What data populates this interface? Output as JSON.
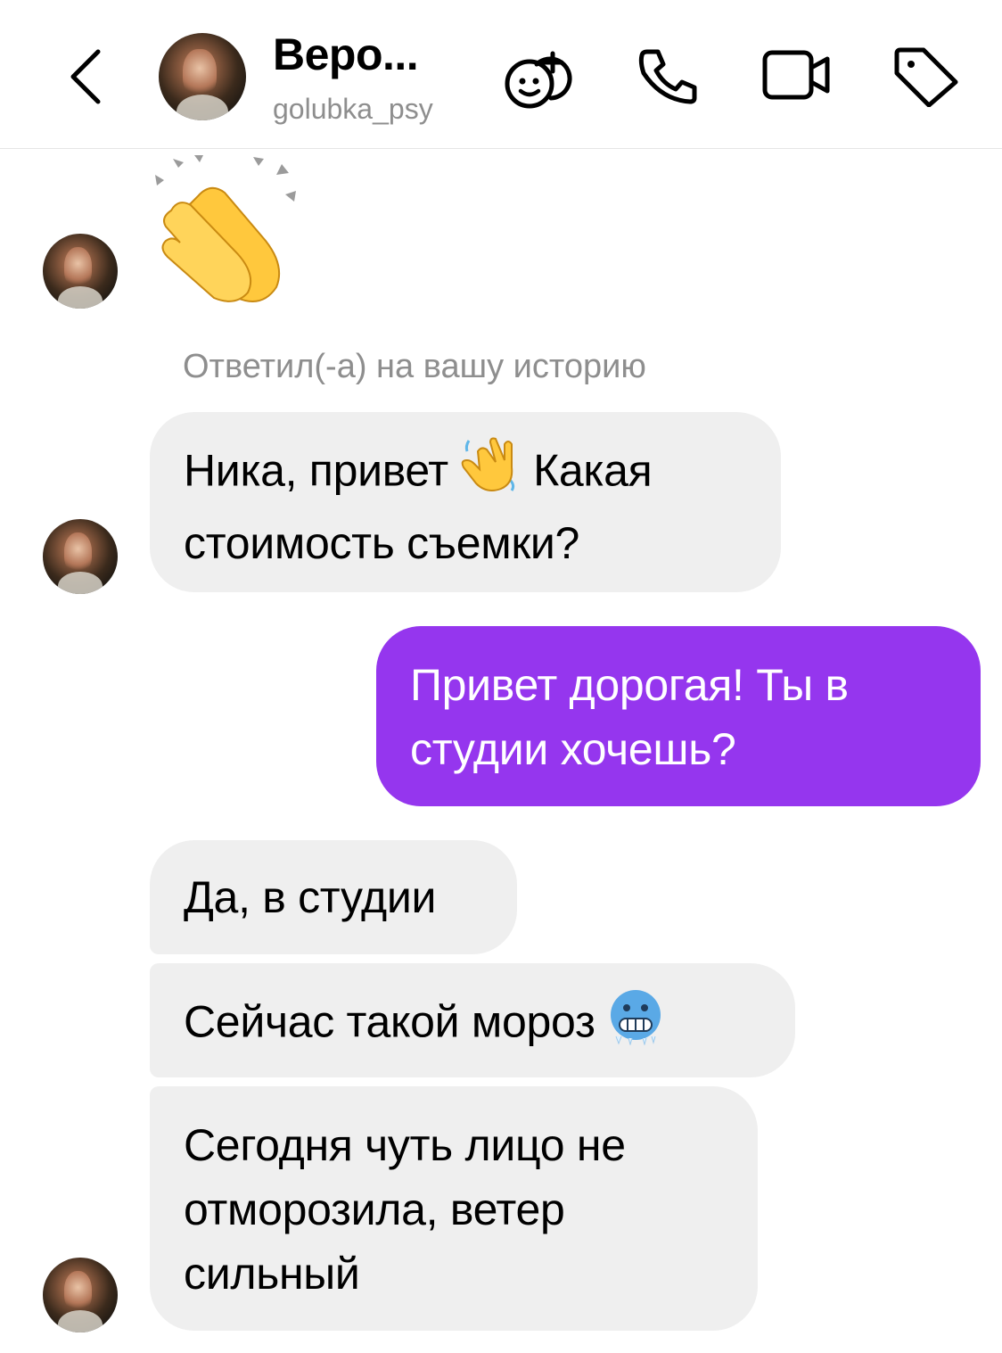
{
  "header": {
    "contact_name": "Веро...",
    "contact_handle": "golubka_psy",
    "icons": [
      "back-chevron-icon",
      "games-icon",
      "phone-icon",
      "video-camera-icon",
      "tag-icon"
    ]
  },
  "thread": {
    "story_reply_note": "Ответил(-а) на вашу историю",
    "messages": [
      {
        "from": "contact",
        "emoji": "clapping-hands"
      },
      {
        "from": "contact",
        "line1": "Ника, привет",
        "line1b": "Какая",
        "line2": "стоимость съемки?",
        "emoji": "waving-hand"
      },
      {
        "from": "me",
        "line1": "Привет дорогая! Ты в",
        "line2": "студии хочешь?"
      },
      {
        "from": "contact",
        "line1": "Да, в студии"
      },
      {
        "from": "contact",
        "line1": "Сейчас такой мороз",
        "emoji": "cold-face"
      },
      {
        "from": "contact",
        "line1": "Сегодня чуть лицо не",
        "line2": "отморозила, ветер",
        "line3": "сильный"
      }
    ]
  },
  "colors": {
    "outgoing_bubble": "#9536ee",
    "incoming_bubble": "#efefef",
    "muted_text": "#8e8e8e"
  }
}
